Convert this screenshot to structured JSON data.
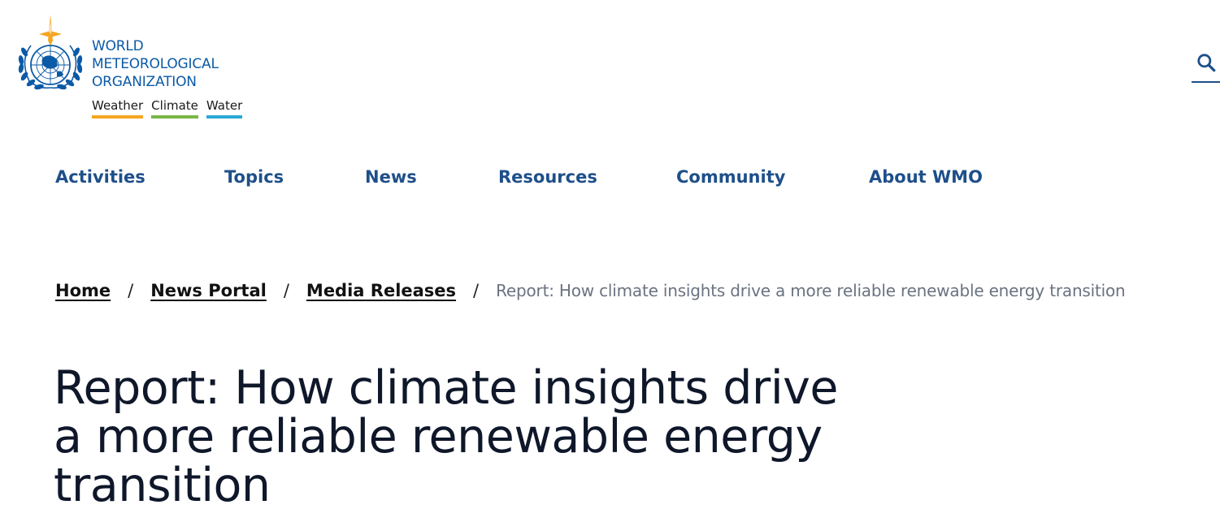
{
  "logo": {
    "line1": "WORLD",
    "line2": "METEOROLOGICAL",
    "line3": "ORGANIZATION",
    "tagline": [
      "Weather",
      "Climate",
      "Water"
    ],
    "colors": {
      "text": "#0b5aa6",
      "weather": "#f5a623",
      "climate": "#7ab648",
      "water": "#29a9d6",
      "star": "#f5a623"
    }
  },
  "search": {
    "icon": "search-icon"
  },
  "nav": {
    "items": [
      "Activities",
      "Topics",
      "News",
      "Resources",
      "Community",
      "About WMO"
    ]
  },
  "breadcrumb": {
    "home": "Home",
    "news_portal": "News Portal",
    "media_releases": "Media Releases",
    "separator": "/",
    "current": "Report: How climate insights drive a more reliable renewable energy transition"
  },
  "page": {
    "title": "Report: How climate insights drive a more reliable renewable energy transition"
  }
}
